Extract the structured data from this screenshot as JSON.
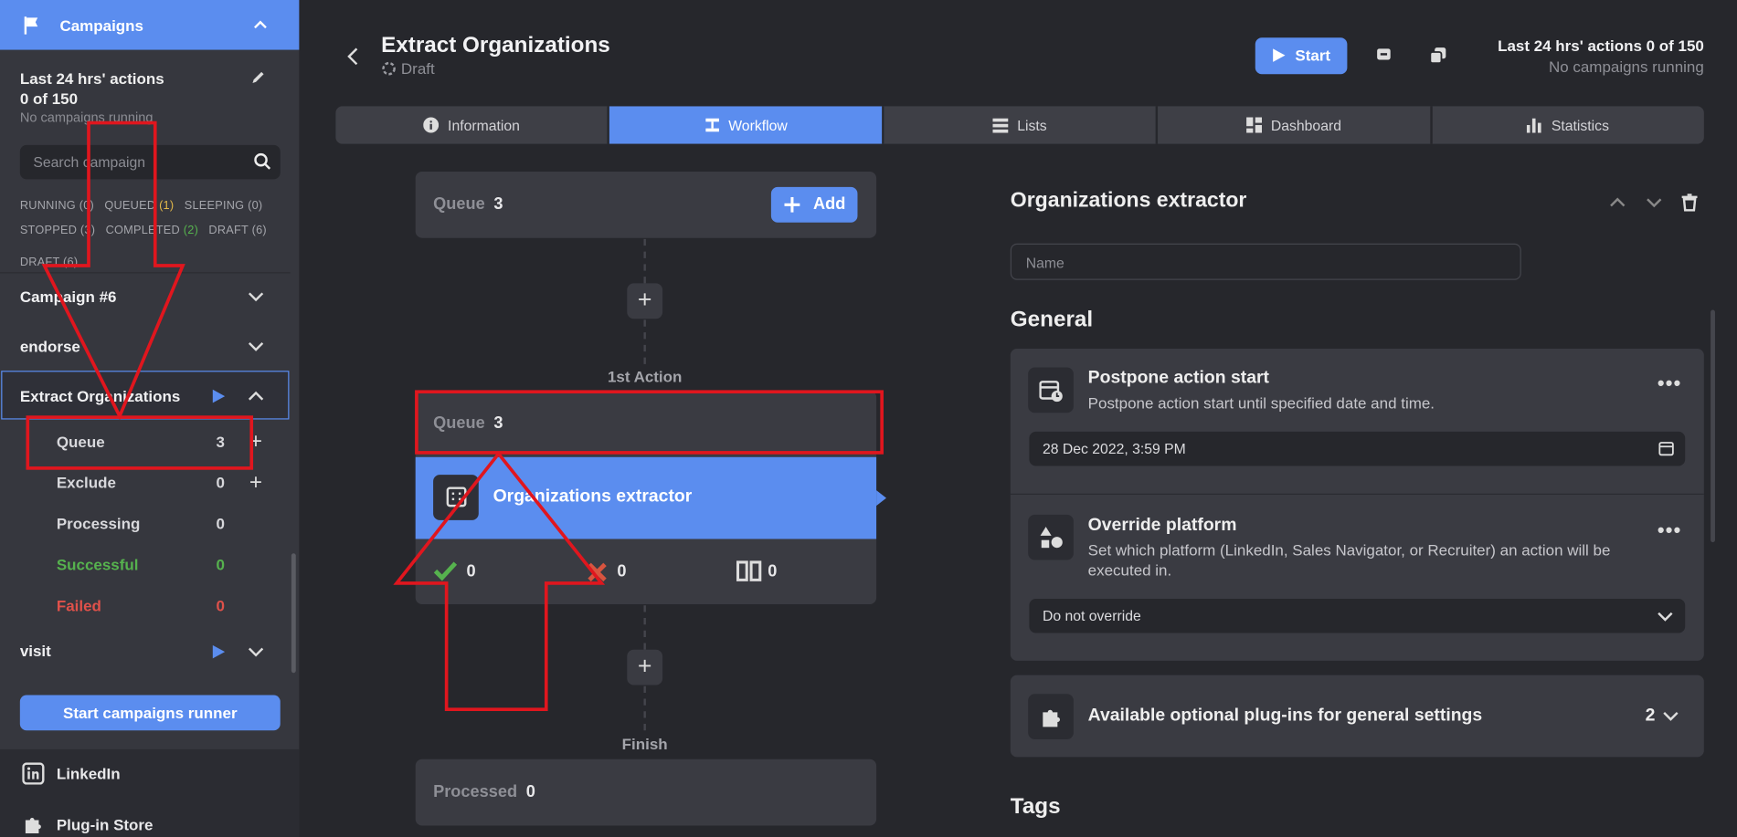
{
  "sidebar": {
    "header_title": "Campaigns",
    "actions_line1": "Last 24 hrs' actions",
    "actions_line2": "0 of 150",
    "no_running": "No campaigns running",
    "search_placeholder": "Search campaign",
    "status_running": "RUNNING (0)",
    "status_queued_label": "QUEUED",
    "status_queued_count": "(1)",
    "status_sleeping": "SLEEPING (0)",
    "status_stopped": "STOPPED (3)",
    "status_completed_label": "COMPLETED",
    "status_completed_count": "(2)",
    "status_draft": "DRAFT (6)",
    "status_draft2": "DRAFT (6)",
    "campaigns": [
      "Campaign #6",
      "endorse",
      "Extract Organizations",
      "visit"
    ],
    "sub_items": [
      {
        "label": "Queue",
        "count": "3"
      },
      {
        "label": "Exclude",
        "count": "0"
      },
      {
        "label": "Processing",
        "count": "0"
      },
      {
        "label": "Successful",
        "count": "0"
      },
      {
        "label": "Failed",
        "count": "0"
      }
    ],
    "runner_button": "Start campaigns runner",
    "footer_items": [
      "LinkedIn",
      "Plug-in Store"
    ]
  },
  "header": {
    "title": "Extract Organizations",
    "status": "Draft",
    "start_label": "Start",
    "last24": "Last 24 hrs' actions 0 of 150",
    "no_running": "No campaigns running"
  },
  "tabs": [
    "Information",
    "Workflow",
    "Lists",
    "Dashboard",
    "Statistics"
  ],
  "active_tab": "Workflow",
  "workflow": {
    "queue_label": "Queue",
    "queue_count": "3",
    "add_label": "Add",
    "first_action_label": "1st Action",
    "action_queue_label": "Queue",
    "action_queue_count": "3",
    "action_name": "Organizations extractor",
    "success_count": "0",
    "fail_count": "0",
    "skip_count": "0",
    "finish_label": "Finish",
    "processed_label": "Processed",
    "processed_count": "0"
  },
  "panel": {
    "title": "Organizations extractor",
    "name_placeholder": "Name",
    "general_heading": "General",
    "postpone_title": "Postpone action start",
    "postpone_desc": "Postpone action start until specified date and time.",
    "postpone_value": "28 Dec 2022, 3:59 PM",
    "override_title": "Override platform",
    "override_desc": "Set which platform (LinkedIn, Sales Navigator, or Recruiter) an action will be executed in.",
    "override_value": "Do not override",
    "plugins_title": "Available optional plug-ins for general settings",
    "plugins_count": "2",
    "tags_heading": "Tags"
  },
  "colors": {
    "accent": "#5b8def",
    "background": "#26272c",
    "annotation": "#e0161e"
  }
}
